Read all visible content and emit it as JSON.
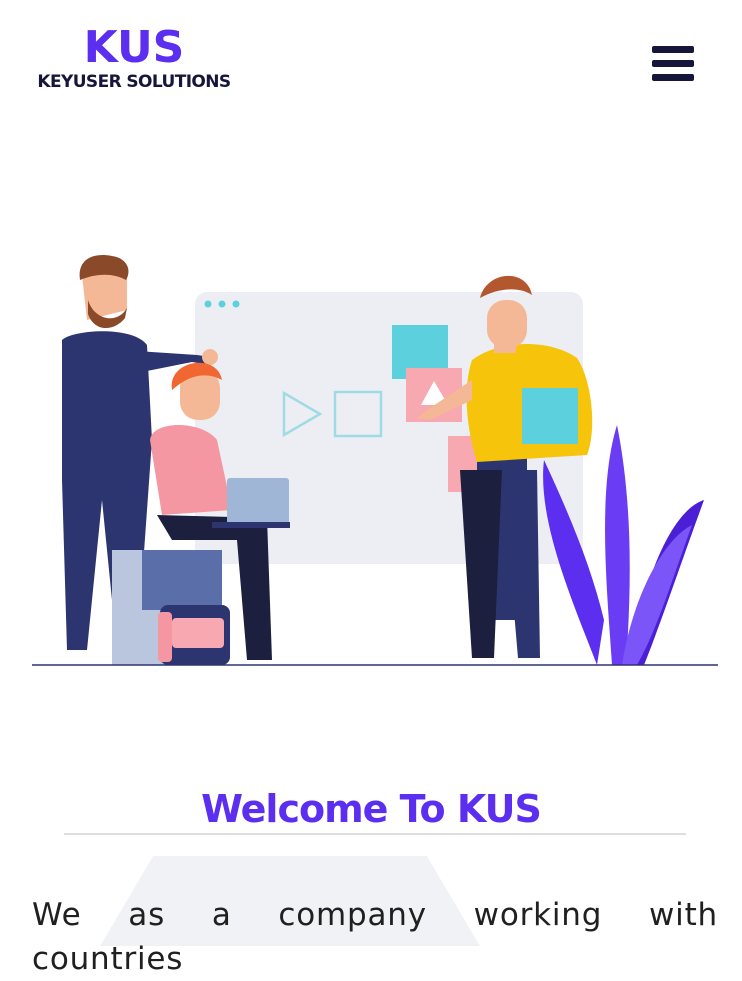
{
  "brand": {
    "name": "KUS",
    "tagline": "KEYUSER SOLUTIONS"
  },
  "header": {
    "menu_icon": "hamburger-menu-icon"
  },
  "hero": {
    "illustration": "team-collaboration-illustration"
  },
  "welcome": {
    "heading": "Welcome To KUS",
    "intro_text": "We as a company working with countries"
  },
  "colors": {
    "brand_purple": "#5b2ef0",
    "navy": "#15163a",
    "board_gray": "#eceef3",
    "teal": "#5dd0dd",
    "pink": "#f7a8b0",
    "yellow": "#f6c40a"
  }
}
